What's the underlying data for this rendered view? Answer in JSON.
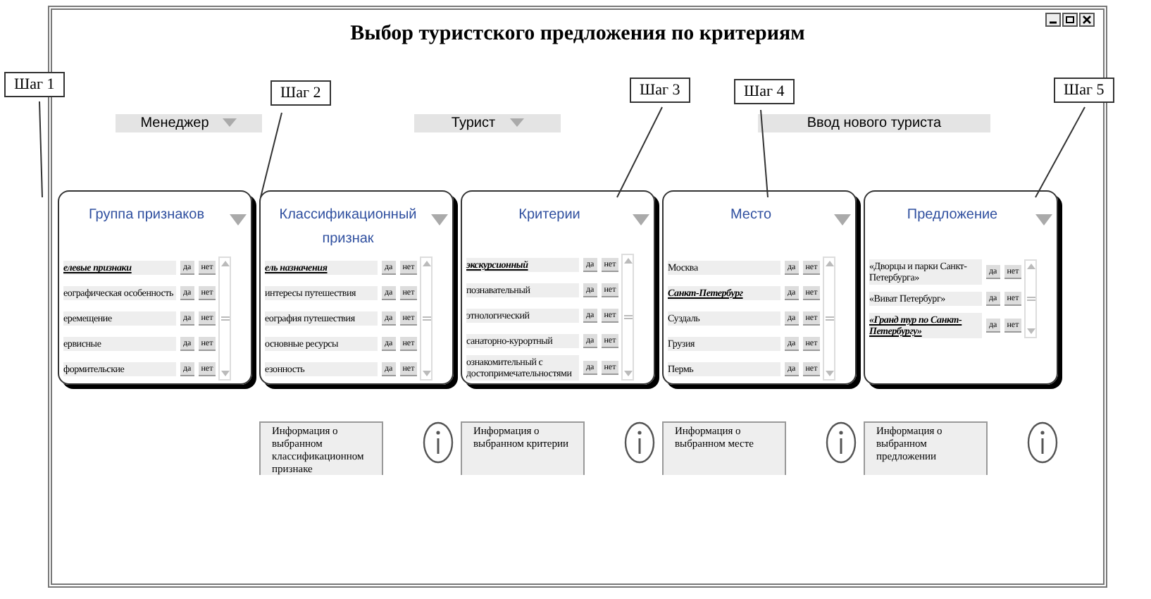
{
  "window": {
    "title": "Выбор туристского предложения по критериям"
  },
  "selectors": [
    {
      "kind": "dropdown",
      "label": "Менеджер"
    },
    {
      "kind": "dropdown",
      "label": "Турист"
    },
    {
      "kind": "button",
      "label": "Ввод нового туриста"
    }
  ],
  "steps": [
    {
      "label": "Шаг 1"
    },
    {
      "label": "Шаг 2"
    },
    {
      "label": "Шаг 3"
    },
    {
      "label": "Шаг 4"
    },
    {
      "label": "Шаг 5"
    }
  ],
  "panels": [
    {
      "title": "Группа признаков",
      "items": [
        {
          "label": "елевые признаки",
          "selected": true,
          "buttons": [
            "да",
            "нет"
          ]
        },
        {
          "label": "еографическая особенность",
          "selected": false,
          "buttons": [
            "да",
            "нет"
          ]
        },
        {
          "label": "еремещение",
          "selected": false,
          "buttons": [
            "да",
            "нет"
          ]
        },
        {
          "label": "ервисные",
          "selected": false,
          "buttons": [
            "да",
            "нет"
          ]
        },
        {
          "label": "формительские",
          "selected": false,
          "buttons": [
            "да",
            "нет"
          ]
        }
      ]
    },
    {
      "title": "Классификационный признак",
      "items": [
        {
          "label": "ель назначения",
          "selected": true,
          "buttons": [
            "да",
            "нет"
          ]
        },
        {
          "label": "интересы путешествия",
          "selected": false,
          "buttons": [
            "да",
            "нет"
          ]
        },
        {
          "label": "еография путешествия",
          "selected": false,
          "buttons": [
            "да",
            "нет"
          ]
        },
        {
          "label": "основные ресурсы",
          "selected": false,
          "buttons": [
            "да",
            "нет"
          ]
        },
        {
          "label": "езонность",
          "selected": false,
          "buttons": [
            "да",
            "нет"
          ]
        }
      ],
      "info": "Информация о выбранном классификационном признаке"
    },
    {
      "title": "Критерии",
      "items": [
        {
          "label": "экскурсионный",
          "selected": true,
          "buttons": [
            "да",
            "нет"
          ]
        },
        {
          "label": "познавательный",
          "selected": false,
          "buttons": [
            "да",
            "нет"
          ]
        },
        {
          "label": "этнологический",
          "selected": false,
          "buttons": [
            "да",
            "нет"
          ]
        },
        {
          "label": "санаторно-курортный",
          "selected": false,
          "buttons": [
            "да",
            "нет"
          ]
        },
        {
          "label": "ознакомительный с достопримечательностями",
          "selected": false,
          "buttons": [
            "да",
            "нет"
          ]
        }
      ],
      "info": "Информация о выбранном критерии"
    },
    {
      "title": "Место",
      "items": [
        {
          "label": "Москва",
          "selected": false,
          "buttons": [
            "да",
            "нет"
          ]
        },
        {
          "label": "Санкт-Петербург",
          "selected": true,
          "buttons": [
            "да",
            "нет"
          ]
        },
        {
          "label": "Суздаль",
          "selected": false,
          "buttons": [
            "да",
            "нет"
          ]
        },
        {
          "label": "Грузия",
          "selected": false,
          "buttons": [
            "да",
            "нет"
          ]
        },
        {
          "label": "Пермь",
          "selected": false,
          "buttons": [
            "да",
            "нет"
          ]
        }
      ],
      "info": "Информация о выбранном месте"
    },
    {
      "title": "Предложение",
      "items": [
        {
          "label": "«Дворцы и парки Санкт-Петербурга»",
          "selected": false,
          "buttons": [
            "да",
            "нет"
          ]
        },
        {
          "label": "«Виват Петербург»",
          "selected": false,
          "buttons": [
            "да",
            "нет"
          ]
        },
        {
          "label": "«Гранд тур по Санкт-Петербургу»",
          "selected": true,
          "buttons": [
            "да",
            "нет"
          ]
        }
      ],
      "info": "Информация о выбранном предложении"
    }
  ]
}
